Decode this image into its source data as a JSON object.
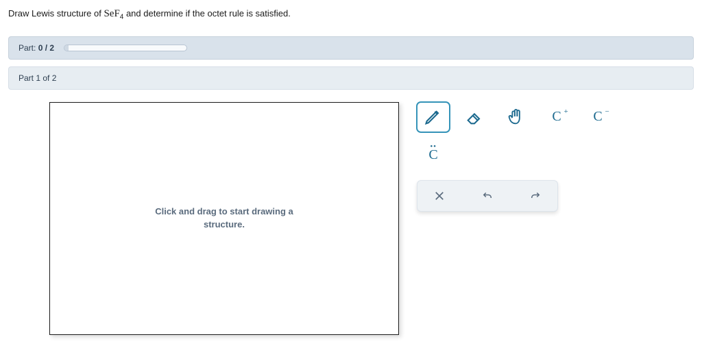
{
  "question": {
    "prefix": "Draw Lewis structure of ",
    "formula_base": "SeF",
    "formula_sub": "4",
    "suffix": " and determine if the octet rule is satisfied."
  },
  "progress": {
    "part_label": "Part: ",
    "part_value": "0 / 2"
  },
  "section": {
    "label": "Part 1 of 2"
  },
  "canvas": {
    "placeholder_l1": "Click and drag to start drawing a",
    "placeholder_l2": "structure."
  },
  "tools": {
    "pencil": "pencil-icon",
    "eraser": "eraser-icon",
    "hand": "hand-icon",
    "cplus": "C",
    "cplus_sup": "+",
    "cminus": "C",
    "cminus_sup": "−",
    "clone": "C",
    "clone_dots": "••"
  },
  "actions": {
    "clear": "clear-icon",
    "undo": "undo-icon",
    "redo": "redo-icon"
  }
}
